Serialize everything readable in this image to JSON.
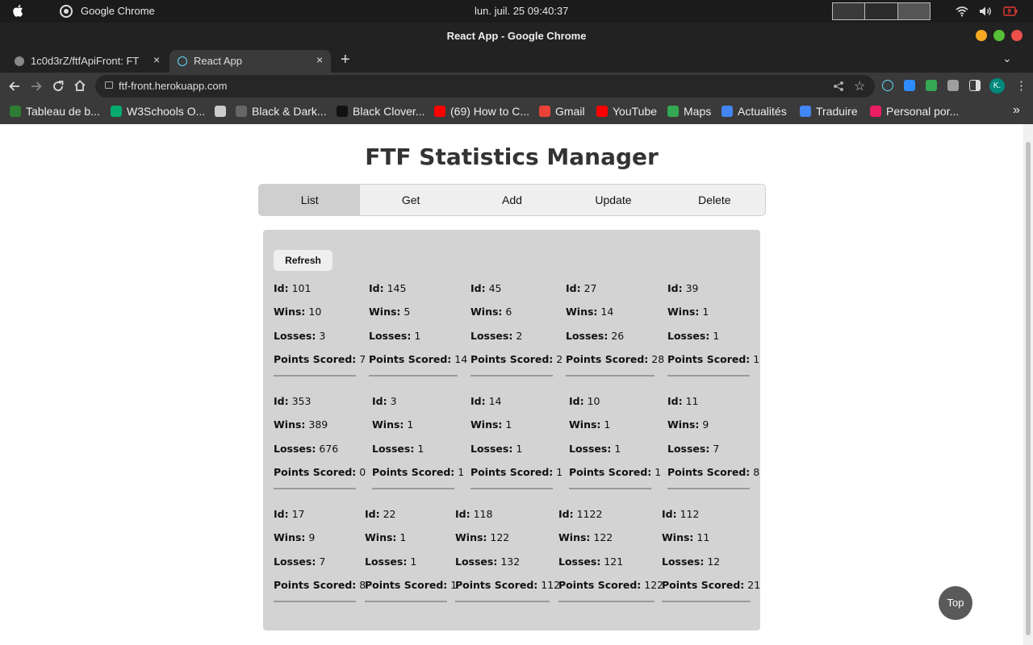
{
  "os_bar": {
    "app_name": "Google Chrome",
    "clock": "lun. juil. 25  09:40:37"
  },
  "window": {
    "title": "React App - Google Chrome"
  },
  "tabs": [
    {
      "label": "1c0d3rZ/ftfApiFront: FT",
      "close": "×"
    },
    {
      "label": "React App",
      "close": "×"
    }
  ],
  "new_tab": "+",
  "tab_menu": "⌄",
  "toolbar": {
    "url": "ftf-front.herokuapp.com",
    "profile_initial": "K."
  },
  "bookmarks": [
    {
      "label": "Tableau de b...",
      "color": "#2e7d32"
    },
    {
      "label": "W3Schools O...",
      "color": "#04aa6d"
    },
    {
      "label": "",
      "color": "#cccccc"
    },
    {
      "label": "Black & Dark...",
      "color": "#666666"
    },
    {
      "label": "Black Clover...",
      "color": "#111111"
    },
    {
      "label": "(69) How to C...",
      "color": "#ff0000"
    },
    {
      "label": "Gmail",
      "color": "#ea4335"
    },
    {
      "label": "YouTube",
      "color": "#ff0000"
    },
    {
      "label": "Maps",
      "color": "#34a853"
    },
    {
      "label": "Actualités",
      "color": "#4285f4"
    },
    {
      "label": "Traduire",
      "color": "#4285f4"
    },
    {
      "label": "Personal por...",
      "color": "#e91e63"
    }
  ],
  "bookmarks_more": "»",
  "page": {
    "title": "FTF Statistics Manager",
    "menu": [
      "List",
      "Get",
      "Add",
      "Update",
      "Delete"
    ],
    "active_menu": "List",
    "refresh_label": "Refresh",
    "top_label": "Top",
    "field_labels": {
      "id": "Id:",
      "wins": "Wins:",
      "losses": "Losses:",
      "points": "Points Scored:"
    },
    "stats": [
      {
        "id": "101",
        "wins": "10",
        "losses": "3",
        "points": "7"
      },
      {
        "id": "145",
        "wins": "5",
        "losses": "1",
        "points": "14"
      },
      {
        "id": "45",
        "wins": "6",
        "losses": "2",
        "points": "2"
      },
      {
        "id": "27",
        "wins": "14",
        "losses": "26",
        "points": "28"
      },
      {
        "id": "39",
        "wins": "1",
        "losses": "1",
        "points": "1"
      },
      {
        "id": "353",
        "wins": "389",
        "losses": "676",
        "points": "0"
      },
      {
        "id": "3",
        "wins": "1",
        "losses": "1",
        "points": "1"
      },
      {
        "id": "14",
        "wins": "1",
        "losses": "1",
        "points": "1"
      },
      {
        "id": "10",
        "wins": "1",
        "losses": "1",
        "points": "1"
      },
      {
        "id": "11",
        "wins": "9",
        "losses": "7",
        "points": "8"
      },
      {
        "id": "17",
        "wins": "9",
        "losses": "7",
        "points": "8"
      },
      {
        "id": "22",
        "wins": "1",
        "losses": "1",
        "points": "1"
      },
      {
        "id": "118",
        "wins": "122",
        "losses": "132",
        "points": "112"
      },
      {
        "id": "1122",
        "wins": "122",
        "losses": "121",
        "points": "122"
      },
      {
        "id": "112",
        "wins": "11",
        "losses": "12",
        "points": "21"
      }
    ]
  }
}
